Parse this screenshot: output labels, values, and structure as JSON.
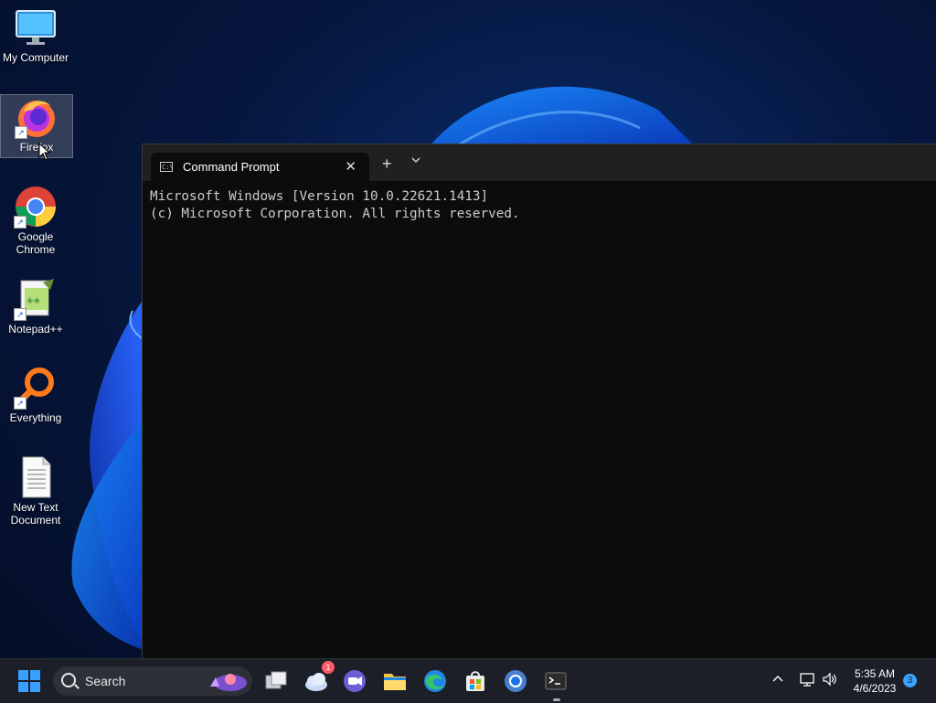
{
  "desktop": {
    "icons": [
      {
        "label": "My Computer"
      },
      {
        "label": "Firefox"
      },
      {
        "label": "Google Chrome"
      },
      {
        "label": "Notepad++"
      },
      {
        "label": "Everything"
      },
      {
        "label": "New Text Document"
      }
    ]
  },
  "terminal": {
    "tab_title": "Command Prompt",
    "tab_close": "✕",
    "new_tab": "+",
    "dropdown": "⌄",
    "lines": [
      "Microsoft Windows [Version 10.0.22621.1413]",
      "(c) Microsoft Corporation. All rights reserved."
    ]
  },
  "taskbar": {
    "search_label": "Search",
    "widgets_badge": "1",
    "tray_chevron": "^",
    "time": "5:35 AM",
    "date": "4/6/2023",
    "notification_count": "3"
  },
  "colors": {
    "console_bg": "#0c0c0c",
    "console_text": "#cccccc",
    "taskbar_bg": "#1c1f27",
    "accent": "#1a73e8"
  }
}
